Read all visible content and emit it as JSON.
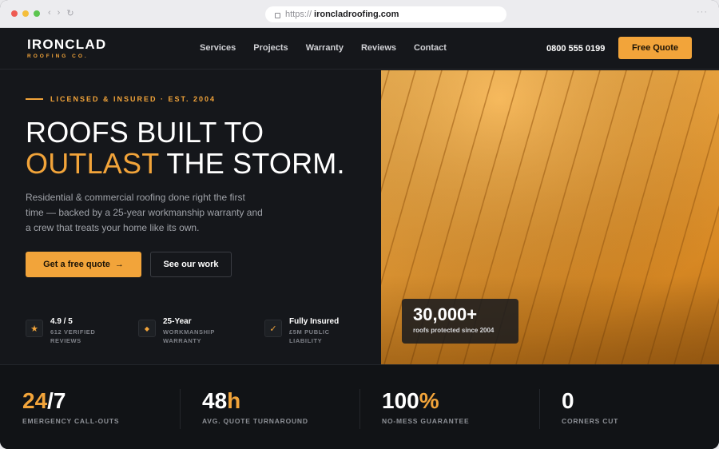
{
  "browser": {
    "protocol": "https://",
    "host": "ironcladroofing.com",
    "more": "···"
  },
  "nav": {
    "logo_main": "IRONCLAD",
    "logo_sub": "ROOFING CO.",
    "links": [
      "Services",
      "Projects",
      "Warranty",
      "Reviews",
      "Contact"
    ],
    "phone": "0800 555 0199",
    "quote_button": "Free Quote"
  },
  "hero": {
    "eyebrow": "LICENSED & INSURED · EST. 2004",
    "headline_line1": "ROOFS BUILT TO",
    "headline_accent": "OUTLAST",
    "headline_rest": " THE STORM.",
    "lead": "Residential & commercial roofing done right the first time — backed by a 25-year workmanship warranty and a crew that treats your home like its own.",
    "cta_primary": "Get a free quote",
    "cta_primary_arrow": "→",
    "cta_secondary": "See our work",
    "trust": [
      {
        "icon": "star-icon",
        "glyph": "★",
        "title": "4.9 / 5",
        "sub": "612 VERIFIED REVIEWS"
      },
      {
        "icon": "diamond-icon",
        "glyph": "◆",
        "title": "25-Year",
        "sub": "WORKMANSHIP WARRANTY"
      },
      {
        "icon": "check-icon",
        "glyph": "✓",
        "title": "Fully Insured",
        "sub": "£5M PUBLIC LIABILITY"
      }
    ],
    "stat_card": {
      "value": "30,000+",
      "caption": "roofs protected since 2004"
    }
  },
  "stats": [
    {
      "accent": "24",
      "rest": "/7",
      "label": "EMERGENCY CALL-OUTS"
    },
    {
      "pre": "48",
      "accent": "h",
      "label": "AVG. QUOTE TURNAROUND"
    },
    {
      "pre": "100",
      "accent": "%",
      "label": "NO-MESS GUARANTEE"
    },
    {
      "pre": "0",
      "label": "CORNERS CUT"
    }
  ],
  "colors": {
    "accent": "#f2a43a",
    "background": "#15171b",
    "band": "#111316"
  }
}
